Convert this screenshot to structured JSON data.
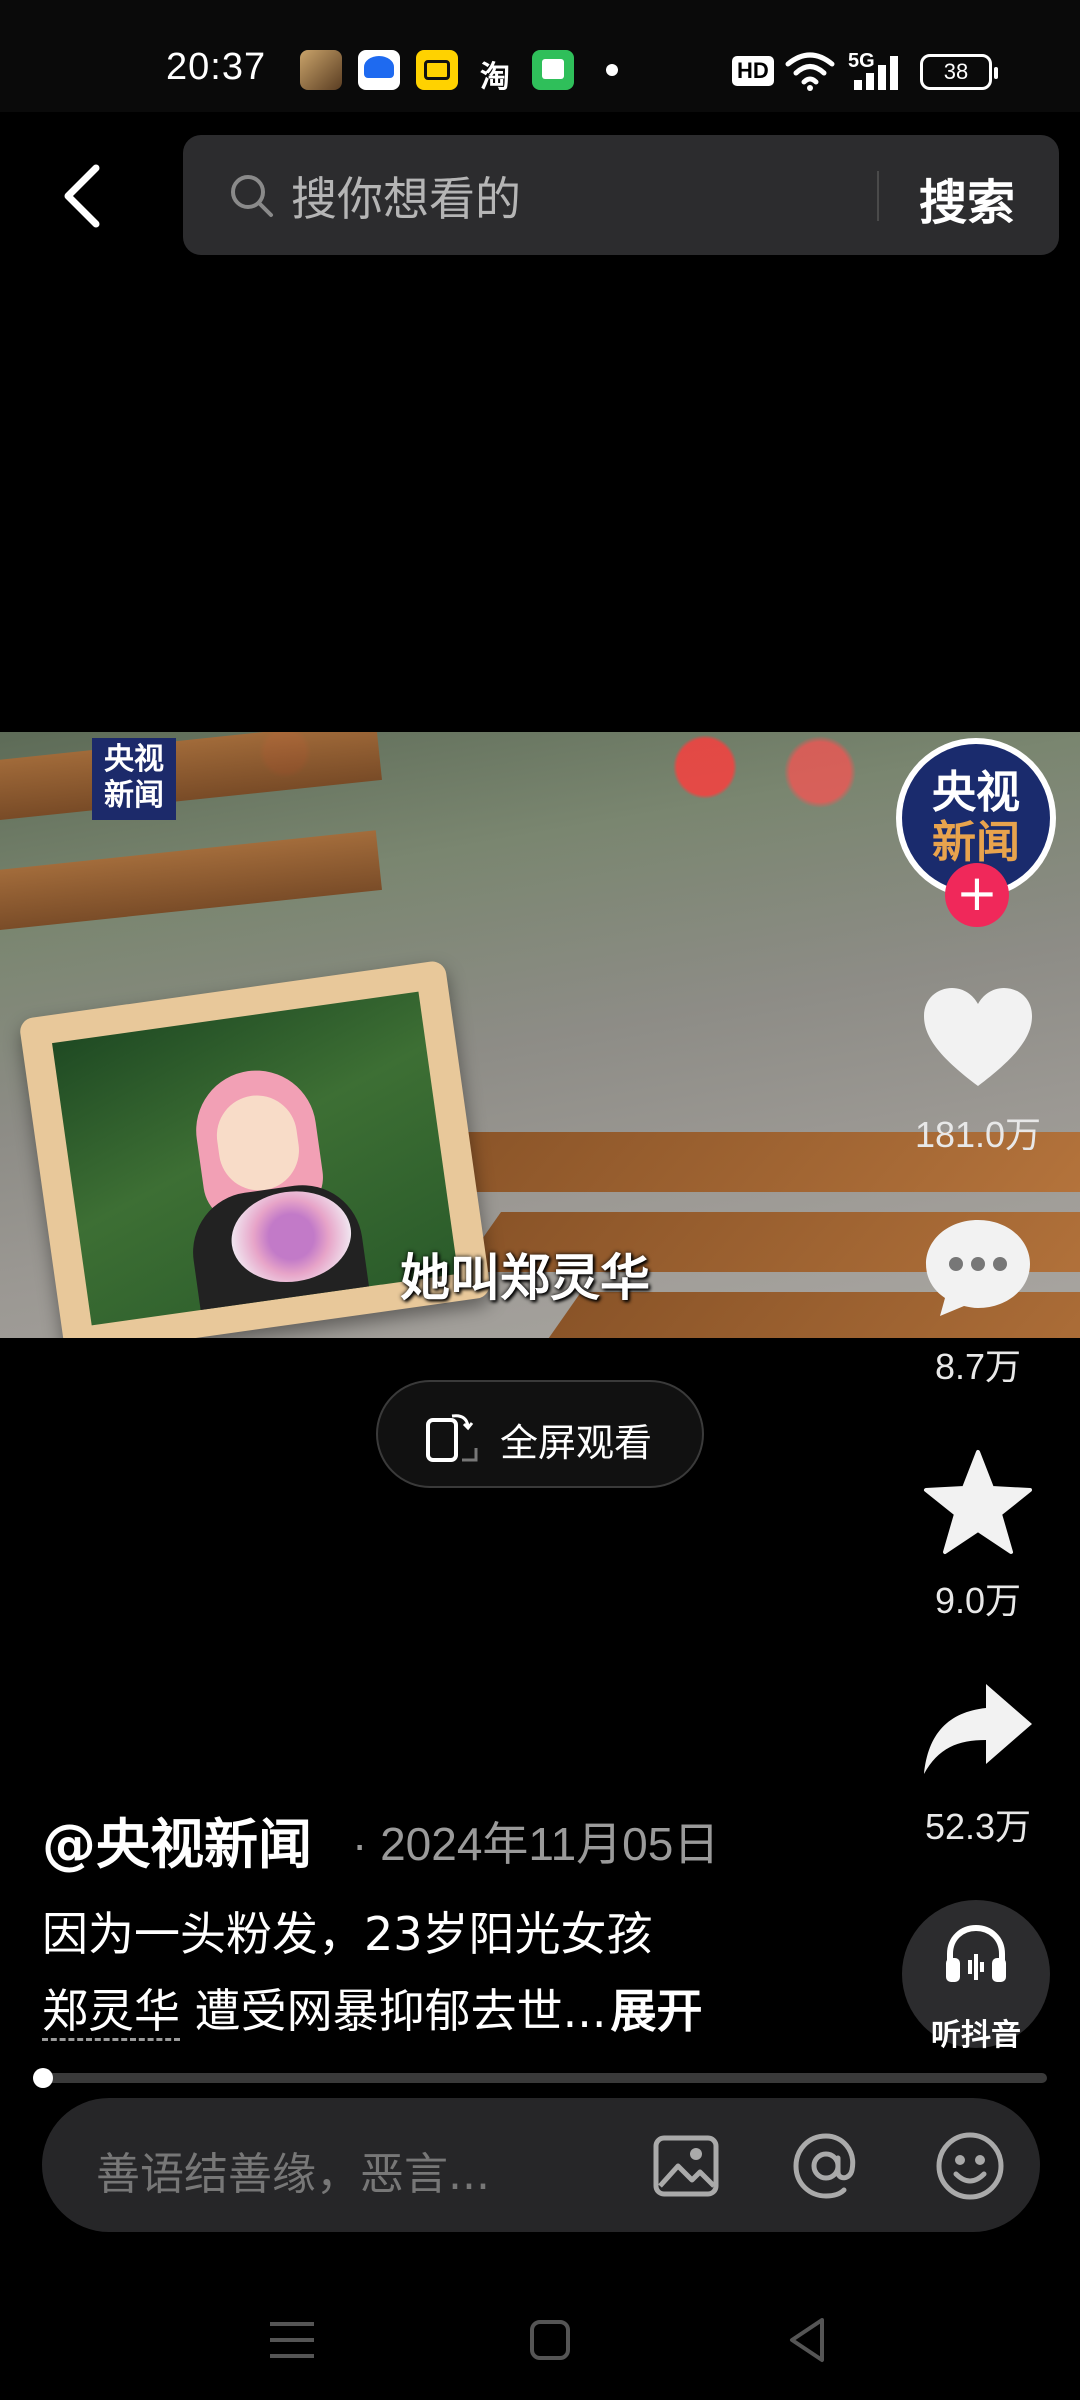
{
  "status_bar": {
    "time": "20:37",
    "taobao_label": "淘",
    "hd_label": "HD",
    "network_label": "5G",
    "battery": "38"
  },
  "header": {
    "search_placeholder": "搜你想看的",
    "search_button": "搜索"
  },
  "video": {
    "channel_logo_top": "央视",
    "channel_logo_bottom": "新闻",
    "subtitle": "她叫郑灵华",
    "fullscreen_label": "全屏观看"
  },
  "rail": {
    "avatar_top": "央视",
    "avatar_bottom": "新闻",
    "follow": "+",
    "likes": "181.0万",
    "comments": "8.7万",
    "favorites": "9.0万",
    "shares": "52.3万",
    "listen_label": "听抖音"
  },
  "caption": {
    "author": "@央视新闻",
    "date": "· 2024年11月05日",
    "line1": "因为一头粉发，23岁阳光女孩",
    "tag": "郑灵华",
    "line2_rest": " 遭受网暴抑郁去世...",
    "expand": "展开"
  },
  "progress": {
    "fraction": 0.01
  },
  "comment_bar": {
    "placeholder": "善语结善缘，恶言..."
  },
  "colors": {
    "accent": "#f0285a",
    "avatar_blue": "#1a2b6d",
    "logo_orange": "#e8a34d"
  }
}
